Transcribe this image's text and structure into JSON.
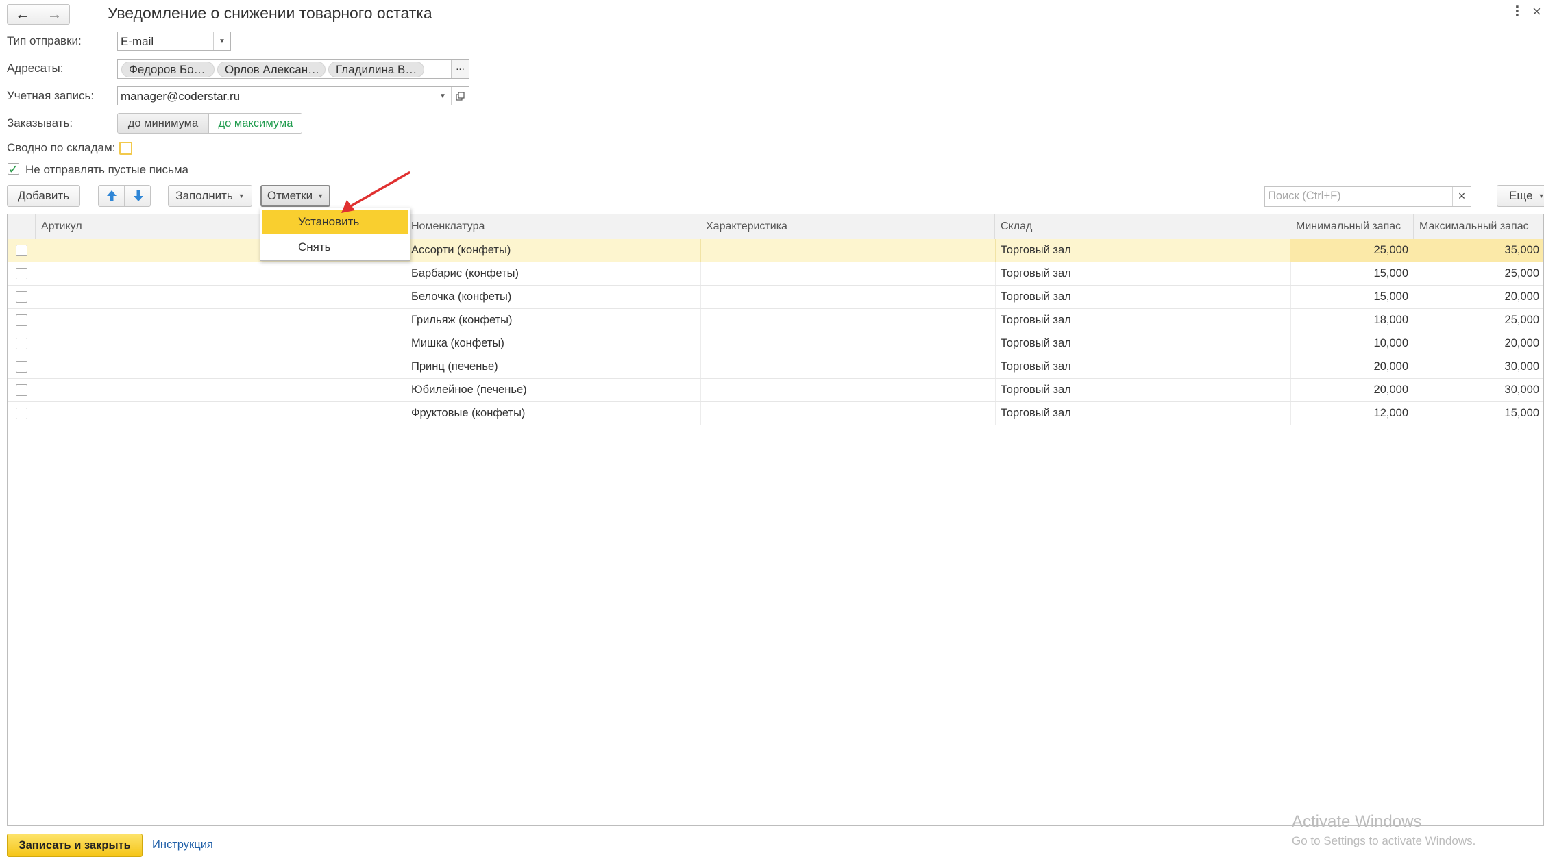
{
  "window": {
    "title": "Уведомление о снижении товарного остатка",
    "back_icon": "arrow-left-icon",
    "forward_icon": "arrow-right-icon",
    "more_icon": "more-vertical-icon",
    "close_icon": "close-icon"
  },
  "form": {
    "send_type": {
      "label": "Тип отправки:",
      "value": "E-mail"
    },
    "recipients": {
      "label": "Адресаты:",
      "chips": [
        "Федоров Бо…",
        "Орлов Алексан…",
        "Гладилина В…"
      ],
      "more": "..."
    },
    "account": {
      "label": "Учетная запись:",
      "value": "manager@coderstar.ru"
    },
    "order": {
      "label": "Заказывать:",
      "options": [
        "до минимума",
        "до максимума"
      ],
      "selected": "до максимума"
    },
    "summary": {
      "label": "Сводно по складам:",
      "checked": false
    },
    "no_empty": {
      "label": "Не отправлять пустые письма",
      "checked": true
    }
  },
  "toolbar": {
    "add": "Добавить",
    "fill": "Заполнить",
    "marks": "Отметки",
    "search_placeholder": "Поиск (Ctrl+F)",
    "more": "Еще"
  },
  "marks_menu": {
    "items": [
      "Установить",
      "Снять"
    ],
    "highlighted": "Установить"
  },
  "table": {
    "columns": [
      "Артикул",
      "Номенклатура",
      "Характеристика",
      "Склад",
      "Минимальный запас",
      "Максимальный запас"
    ],
    "rows": [
      {
        "article": "",
        "item": "Ассорти (конфеты)",
        "characteristic": "",
        "warehouse": "Торговый зал",
        "min": "25,000",
        "max": "35,000"
      },
      {
        "article": "",
        "item": "Барбарис (конфеты)",
        "characteristic": "",
        "warehouse": "Торговый зал",
        "min": "15,000",
        "max": "25,000"
      },
      {
        "article": "",
        "item": "Белочка (конфеты)",
        "characteristic": "",
        "warehouse": "Торговый зал",
        "min": "15,000",
        "max": "20,000"
      },
      {
        "article": "",
        "item": "Грильяж (конфеты)",
        "characteristic": "",
        "warehouse": "Торговый зал",
        "min": "18,000",
        "max": "25,000"
      },
      {
        "article": "",
        "item": "Мишка (конфеты)",
        "characteristic": "",
        "warehouse": "Торговый зал",
        "min": "10,000",
        "max": "20,000"
      },
      {
        "article": "",
        "item": "Принц (печенье)",
        "characteristic": "",
        "warehouse": "Торговый зал",
        "min": "20,000",
        "max": "30,000"
      },
      {
        "article": "",
        "item": "Юбилейное (печенье)",
        "characteristic": "",
        "warehouse": "Торговый зал",
        "min": "20,000",
        "max": "30,000"
      },
      {
        "article": "",
        "item": "Фруктовые (конфеты)",
        "characteristic": "",
        "warehouse": "Торговый зал",
        "min": "12,000",
        "max": "15,000"
      }
    ],
    "selected_row": 0
  },
  "footer": {
    "save_close": "Записать и закрыть",
    "help": "Инструкция"
  },
  "watermark": {
    "line1": "Activate Windows",
    "line2": "Go to Settings to activate Windows."
  },
  "colors": {
    "accent_yellow": "#f9cf2f",
    "selected_row": "#fdf5cf",
    "link": "#1f5fa8",
    "green_text": "#1f9b4d",
    "nav_arrow_blue": "#2f86d6",
    "annotation_red": "#e03030"
  }
}
